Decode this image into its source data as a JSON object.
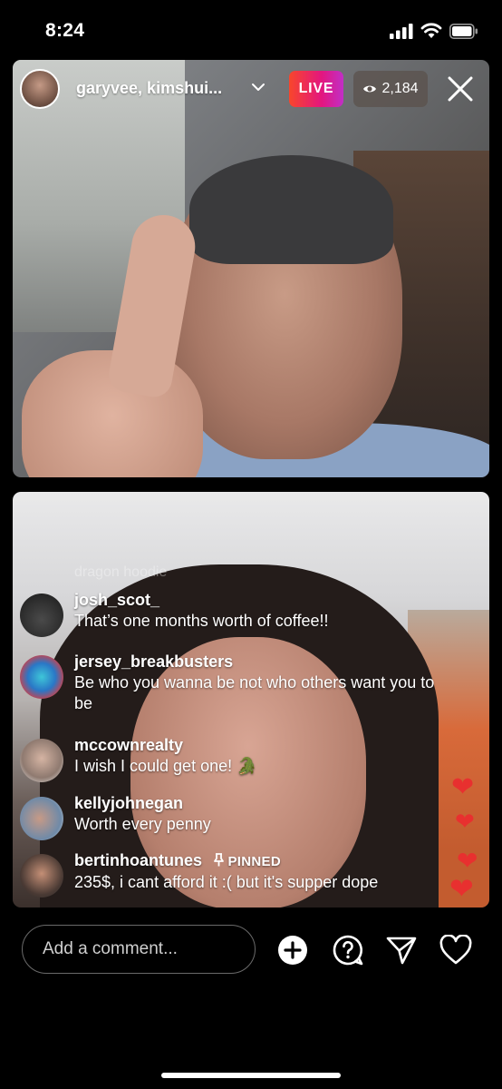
{
  "status_bar": {
    "time": "8:24",
    "icons": [
      "signal-icon",
      "wifi-icon",
      "battery-icon"
    ]
  },
  "live_header": {
    "broadcasters": "garyvee, kimshui...",
    "live_badge": "LIVE",
    "viewer_count": "2,184",
    "icons": [
      "chevron-down-icon",
      "eye-icon",
      "close-icon"
    ]
  },
  "comments": [
    {
      "username": "josh_scot_",
      "message": "That’s one months worth of coffee!!"
    },
    {
      "username": "jersey_breakbusters",
      "message": "Be who you wanna be not who others want you to be"
    },
    {
      "username": "mccownrealty",
      "message": "I wish I could get one! 🐊"
    },
    {
      "username": "kellyjohnegan",
      "message": "Worth every penny"
    },
    {
      "username": "bertinhoantunes",
      "message": "235$, i cant afford it :( but it's supper dope",
      "pinned_label": "PINNED"
    }
  ],
  "faded_comment_text": "dragon hoodie",
  "bottom_bar": {
    "comment_placeholder": "Add a comment...",
    "icons": [
      "add-circle-icon",
      "question-icon",
      "send-icon",
      "heart-icon"
    ]
  },
  "colors": {
    "live_gradient_start": "#f8462b",
    "live_gradient_end": "#c12fc6",
    "heart_red": "#e8302f"
  }
}
